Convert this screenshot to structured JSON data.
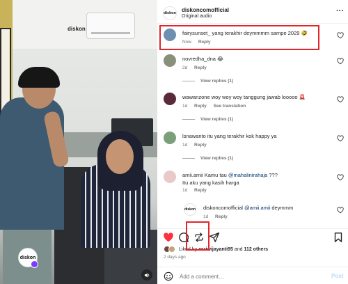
{
  "video": {
    "wall_logo": "diskon",
    "brand_badge": "diskon"
  },
  "header": {
    "avatar_text": "diskon",
    "username": "diskoncomofficial",
    "audio": "Original audio",
    "more": "···"
  },
  "comments": [
    {
      "user": "fairysunset_",
      "text": "yang terakhir deymmmm sampe 2029 🤣",
      "time": "Now",
      "reply": "Reply",
      "avatar_color": "#6f8fb0"
    },
    {
      "user": "novredha_dna",
      "text": "😂",
      "time": "2d",
      "reply": "Reply",
      "view_replies": "View replies (1)",
      "avatar_color": "#8a8f7a"
    },
    {
      "user": "wawanzone",
      "text": "woy woy woy tanggung jawab looooo 🚨",
      "time": "1d",
      "reply": "Reply",
      "see_translation": "See translation",
      "view_replies": "View replies (1)",
      "avatar_color": "#5a2a3a"
    },
    {
      "user": "lsnawanto",
      "text": "itu yang terakhir kok happy ya",
      "time": "1d",
      "reply": "Reply",
      "view_replies": "View replies (1)",
      "avatar_color": "#7aa07a"
    },
    {
      "user": "amii.amii",
      "text_pre": "Kamu tau",
      "mention": "@mahalinirahaja",
      "text_post": "???",
      "text_line2": "Itu aku yang kasih harga",
      "time": "1d",
      "reply": "Reply",
      "avatar_color": "#e9c9c9"
    },
    {
      "user": "diskoncomofficial",
      "mention": "@amii.amii",
      "text_post": "deymmm",
      "time": "1d",
      "reply": "Reply",
      "avatar_text": "diskon"
    }
  ],
  "likes": {
    "prefix": "Liked by",
    "user": "asriwijayanti95",
    "and": "and",
    "others": "112 others"
  },
  "time_ago": "2 days ago",
  "add_comment": {
    "placeholder": "Add a comment…",
    "post_label": "Post"
  },
  "colors": {
    "highlight": "#e0262c",
    "like_red": "#ff3040",
    "link": "#00376b"
  }
}
